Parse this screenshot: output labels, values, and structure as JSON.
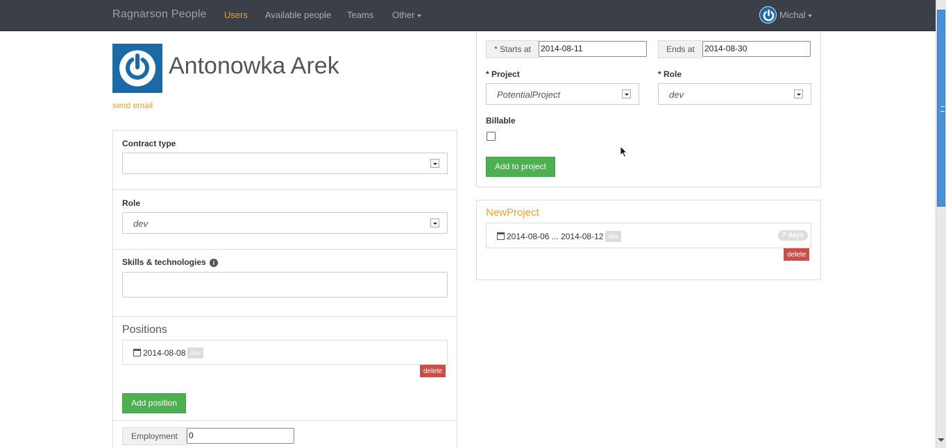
{
  "navbar": {
    "brand": "Ragnarson People",
    "links": [
      "Users",
      "Available people",
      "Teams",
      "Other"
    ],
    "user_name": "Michal"
  },
  "profile": {
    "name": "Antonowka Arek",
    "send_email": "send email"
  },
  "left": {
    "contract_type_label": "Contract type",
    "contract_type_value": "",
    "role_label": "Role",
    "role_value": "dev",
    "skills_label": "Skills & technologies",
    "positions_title": "Positions",
    "position": {
      "date": "2014-08-08",
      "role": "dev"
    },
    "delete_label": "delete",
    "add_position_label": "Add position",
    "employment_label": "Employment",
    "employment_value": "0"
  },
  "right": {
    "starts_at_label": "* Starts at",
    "starts_at_value": "2014-08-11",
    "ends_at_label": "Ends at",
    "ends_at_value": "2014-08-30",
    "project_label": "* Project",
    "project_value": "PotentialProject",
    "role_label": "* Role",
    "role_value": "dev",
    "billable_label": "Billable",
    "add_to_project_label": "Add to project"
  },
  "membership": {
    "project_name": "NewProject",
    "date_range": "2014-08-06 ... 2014-08-12",
    "role": "dev",
    "duration": "7 days",
    "delete_label": "delete"
  },
  "colors": {
    "accent": "#f0a030",
    "navbar": "#3a3f48",
    "success": "#4caf50",
    "danger": "#d24b44"
  }
}
